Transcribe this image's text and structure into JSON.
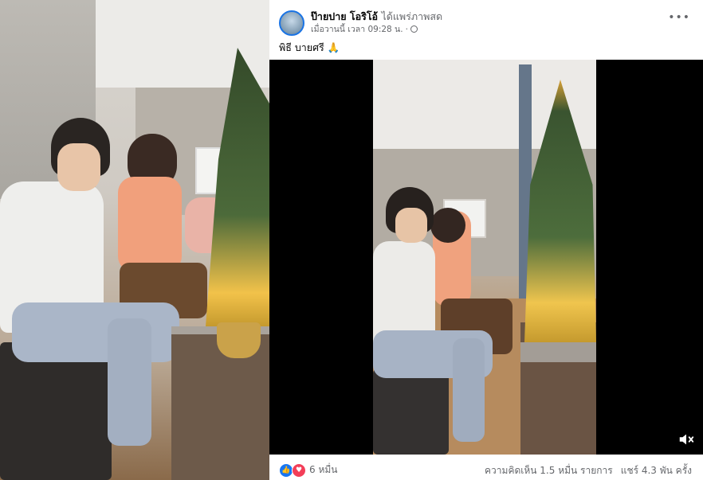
{
  "post": {
    "author": "ป๊ายปาย โอริโอ้",
    "action": "ได้แพร่ภาพสด",
    "time": "เมื่อวานนี้ เวลา 09:28 น.",
    "separator": "·",
    "more_label": "•••",
    "caption": "พิธี บายศรี 🙏",
    "reaction_count": "6 หมื่น",
    "comments": "ความคิดเห็น 1.5 หมื่น รายการ",
    "shares": "แชร์ 4.3 พัน ครั้ง"
  },
  "icons": {
    "audience": "globe-icon",
    "reaction_like": "like-reaction-icon",
    "reaction_love": "love-reaction-icon",
    "mute": "muted-speaker-icon",
    "more": "more-options-icon"
  },
  "colors": {
    "accent": "#1877f2",
    "love": "#f33e58",
    "secondary_text": "#65676b",
    "video_bg": "#000000"
  }
}
